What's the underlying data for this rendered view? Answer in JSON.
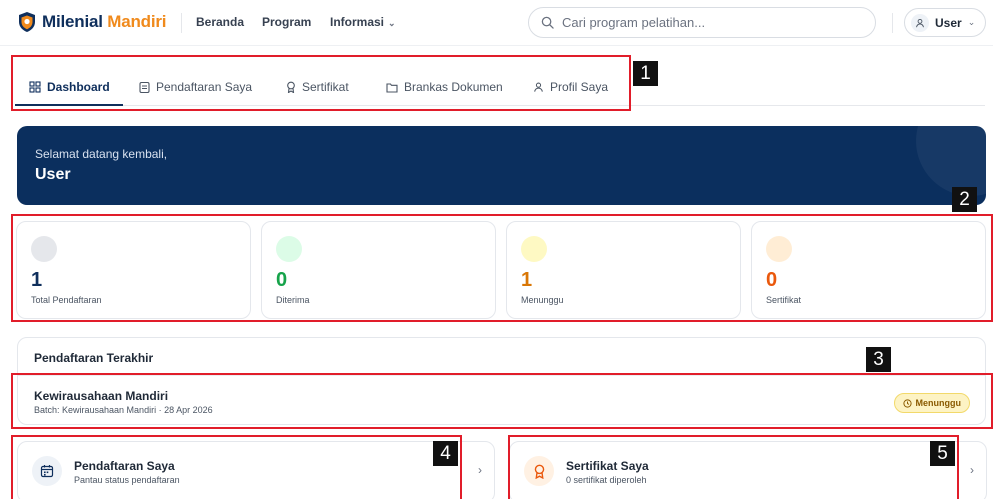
{
  "brand": {
    "name_part1": "Milenial",
    "name_part2": "Mandiri",
    "colors": {
      "navy": "#0f2f5c",
      "orange": "#f08a1c"
    }
  },
  "nav": {
    "links": [
      {
        "label": "Beranda"
      },
      {
        "label": "Program"
      },
      {
        "label": "Informasi"
      }
    ],
    "search_placeholder": "Cari program pelatihan...",
    "user_label": "User"
  },
  "tabs": [
    {
      "label": "Dashboard",
      "icon": "dashboard-grid-icon",
      "active": true
    },
    {
      "label": "Pendaftaran Saya",
      "icon": "clipboard-icon",
      "active": false
    },
    {
      "label": "Sertifikat",
      "icon": "award-icon",
      "active": false
    },
    {
      "label": "Brankas Dokumen",
      "icon": "folder-icon",
      "active": false
    },
    {
      "label": "Profil Saya",
      "icon": "user-icon",
      "active": false
    }
  ],
  "welcome": {
    "greeting": "Selamat datang kembali,",
    "name": "User",
    "bg_color": "#0b2f5e"
  },
  "stats": [
    {
      "value": "1",
      "label": "Total Pendaftaran",
      "value_color": "#0f2f5c",
      "dot_color": "#e5e7eb"
    },
    {
      "value": "0",
      "label": "Diterima",
      "value_color": "#16a34a",
      "dot_color": "#dcfce7"
    },
    {
      "value": "1",
      "label": "Menunggu",
      "value_color": "#d97706",
      "dot_color": "#fef9c3"
    },
    {
      "value": "0",
      "label": "Sertifikat",
      "value_color": "#ea580c",
      "dot_color": "#ffedd5"
    }
  ],
  "recent": {
    "title": "Pendaftaran Terakhir",
    "item_name": "Kewirausahaan Mandiri",
    "item_sub": "Batch: Kewirausahaan Mandiri · 28 Apr 2026",
    "status": "Menunggu",
    "status_icon": "clock-icon"
  },
  "cards": [
    {
      "title": "Pendaftaran Saya",
      "subtitle": "Pantau status pendaftaran",
      "icon": "calendar-icon"
    },
    {
      "title": "Sertifikat Saya",
      "subtitle": "0 sertifikat diperoleh",
      "icon": "award-icon"
    }
  ],
  "annotations": [
    {
      "label": "1"
    },
    {
      "label": "2"
    },
    {
      "label": "3"
    },
    {
      "label": "4"
    },
    {
      "label": "5"
    }
  ]
}
